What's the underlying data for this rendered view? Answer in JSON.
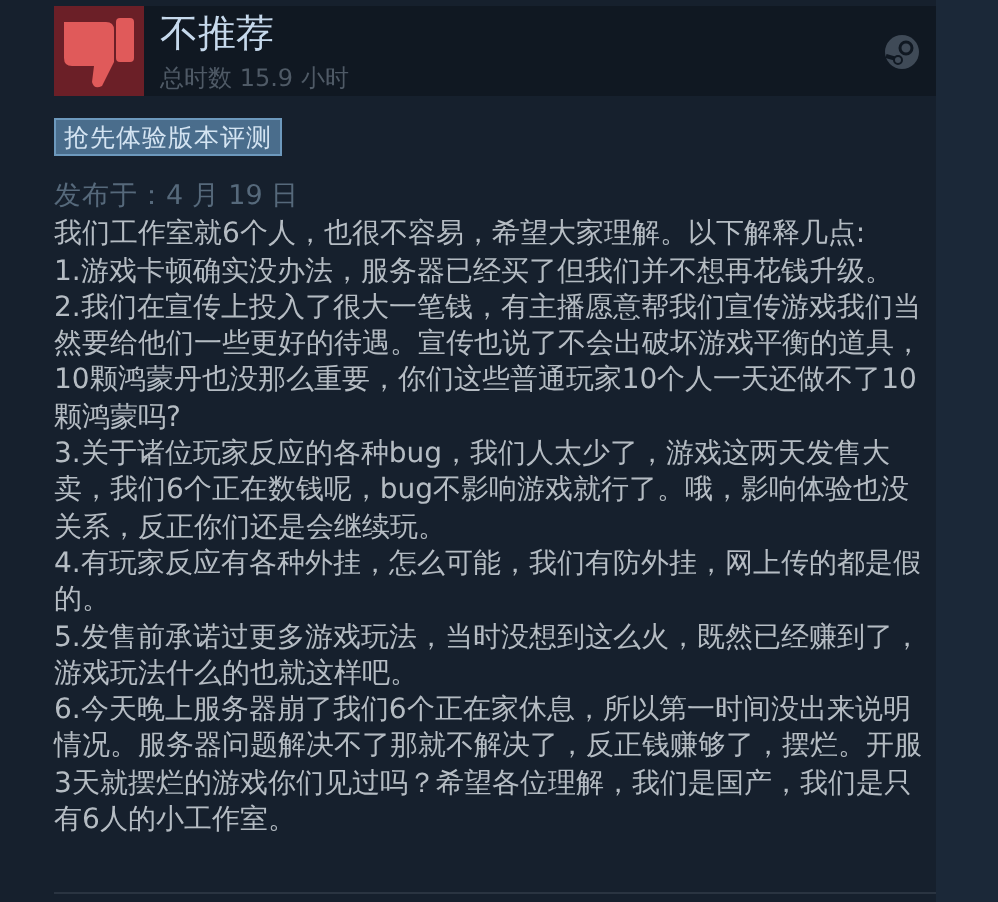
{
  "review": {
    "verdict": "不推荐",
    "recommended": false,
    "playtime": "总时数 15.9 小时",
    "tag": "抢先体验版本评测",
    "posted": "发布于：4 月 19 日",
    "paragraphs": [
      "我们工作室就6个人，也很不容易，希望大家理解。以下解释几点:",
      "1.游戏卡顿确实没办法，服务器已经买了但我们并不想再花钱升级。",
      "2.我们在宣传上投入了很大一笔钱，有主播愿意帮我们宣传游戏我们当然要给他们一些更好的待遇。宣传也说了不会出破坏游戏平衡的道具，10颗鸿蒙丹也没那么重要，你们这些普通玩家10个人一天还做不了10颗鸿蒙吗?",
      "3.关于诸位玩家反应的各种bug，我们人太少了，游戏这两天发售大卖，我们6个正在数钱呢，bug不影响游戏就行了。哦，影响体验也没关系，反正你们还是会继续玩。",
      "4.有玩家反应有各种外挂，怎么可能，我们有防外挂，网上传的都是假的。",
      "5.发售前承诺过更多游戏玩法，当时没想到这么火，既然已经赚到了，游戏玩法什么的也就这样吧。",
      "6.今天晚上服务器崩了我们6个正在家休息，所以第一时间没出来说明情况。服务器问题解决不了那就不解决了，反正钱赚够了，摆烂。开服3天就摆烂的游戏你们见过吗？希望各位理解，我们是国产，我们是只有6人的小工作室。"
    ]
  }
}
